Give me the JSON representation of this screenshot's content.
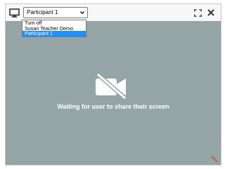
{
  "screen_share": {
    "participant_select": {
      "selected": "Participant 1",
      "options": [
        "Turn off",
        "Susan Teacher Demo",
        "Participant 1"
      ],
      "highlighted_option": "Participant 1"
    },
    "status_message": "Waiting for user to share their screen",
    "icons": {
      "monitor": "monitor-icon",
      "fullscreen": "fullscreen-icon",
      "close": "close-icon",
      "video_off": "video-off-icon",
      "resize": "resize-handle-icon"
    },
    "colors": {
      "stage": "#95a5a6",
      "selected_option": "#1e90ff",
      "resize_handle": "#d9534f"
    }
  }
}
